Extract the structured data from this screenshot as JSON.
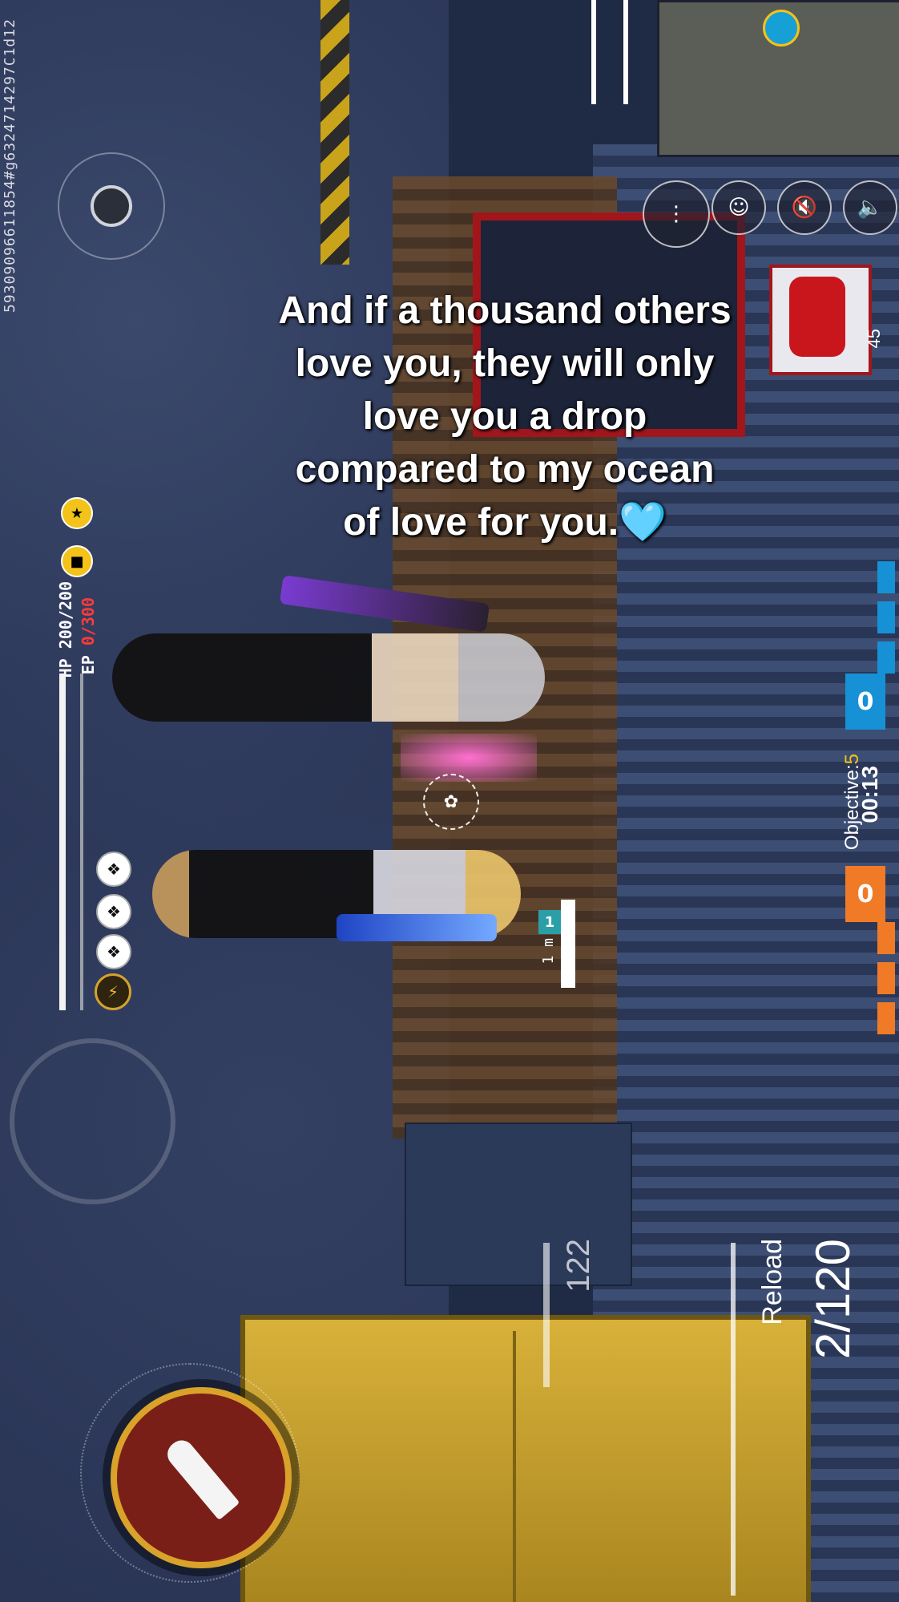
{
  "overlay_caption": {
    "line1": "And if a thousand others",
    "line2": "love you, they will only",
    "line3": "love you a drop",
    "line4": "compared to my ocean",
    "line5": "of love for you.",
    "emoji": "🩵"
  },
  "device_id": "59309096611854#g6324714297C1d12",
  "player_stats": {
    "hp_label": "HP 200/200",
    "ep_prefix": "EP ",
    "ep_value": "0/300"
  },
  "score": {
    "blue_team": "0",
    "orange_team": "0",
    "timer": "00:13",
    "objective_label": "Objective:",
    "objective_value": "5"
  },
  "weapon": {
    "ammo": "2/120",
    "reload_label": "Reload",
    "secondary_count": "122"
  },
  "network": {
    "ping": "45"
  },
  "teammate": {
    "number": "1",
    "distance": "1 m"
  },
  "icons": {
    "joystick": "movement-joystick-icon",
    "fire": "fire-bullet-icon",
    "emote": "emote-icon",
    "chat": "chat-icon",
    "mic": "mic-muted-icon",
    "speaker": "speaker-icon",
    "paw": "paw-crosshair-icon"
  },
  "colors": {
    "blue_team": "#1691d6",
    "orange_team": "#f07a26",
    "ep_red": "#ff3b3b",
    "objective_yellow": "#f3c31a"
  }
}
